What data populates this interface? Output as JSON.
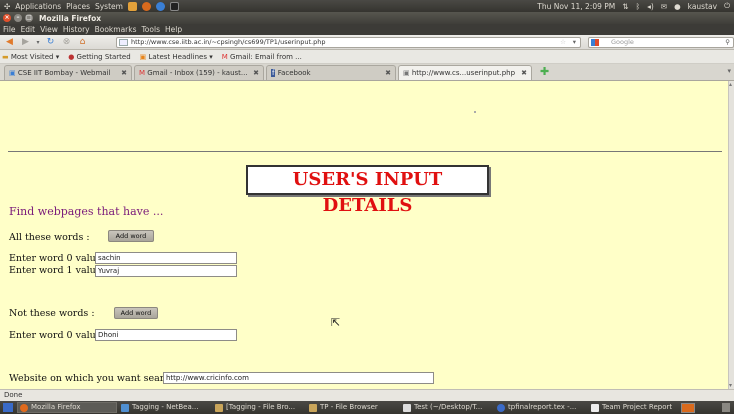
{
  "panel": {
    "menus": [
      "Applications",
      "Places",
      "System"
    ],
    "datetime": "Thu Nov 11,  2:09 PM",
    "user": "kaustav"
  },
  "window": {
    "title": "Mozilla Firefox"
  },
  "menubar": [
    "File",
    "Edit",
    "View",
    "History",
    "Bookmarks",
    "Tools",
    "Help"
  ],
  "navbar": {
    "url": "http://www.cse.iitb.ac.in/~cpsingh/cs699/TP1/userinput.php",
    "search_placeholder": "Google"
  },
  "bookmarks": [
    "Most Visited ▾",
    "Getting Started",
    "Latest Headlines ▾",
    "Gmail: Email from ..."
  ],
  "tabs": [
    {
      "label": "CSE IIT Bombay - Webmail"
    },
    {
      "label": "Gmail - Inbox (159) - kaust..."
    },
    {
      "label": "Facebook"
    },
    {
      "label": "http://www.cs...userinput.php"
    }
  ],
  "page": {
    "heading": "USER'S INPUT DETAILS",
    "find_label": "Find webpages that have ...",
    "all_words_label": "All these words :",
    "not_words_label": "Not these words :",
    "add_word_label": "Add word",
    "all_words": [
      {
        "label": "Enter word 0 value",
        "value": "sachin"
      },
      {
        "label": "Enter word 1 value",
        "value": "Yuvraj"
      }
    ],
    "not_words": [
      {
        "label": "Enter word 0 value",
        "value": "Dhoni"
      }
    ],
    "website_label": "Website on which you want search :",
    "website_value": "http://www.cricinfo.com"
  },
  "status": "Done",
  "taskbar": [
    {
      "label": "Mozilla Firefox",
      "color": "#e06a1c"
    },
    {
      "label": "Tagging - NetBea...",
      "color": "#4f8fd1"
    },
    {
      "label": "[Tagging - File Bro...",
      "color": "#c9a55a"
    },
    {
      "label": "TP - File Browser",
      "color": "#c9a55a"
    },
    {
      "label": "Test (~/Desktop/T...",
      "color": "#dddddd"
    },
    {
      "label": "tpfinalreport.tex -...",
      "color": "#3b6bc8"
    },
    {
      "label": "Team Project Report",
      "color": "#eeeeee"
    }
  ]
}
